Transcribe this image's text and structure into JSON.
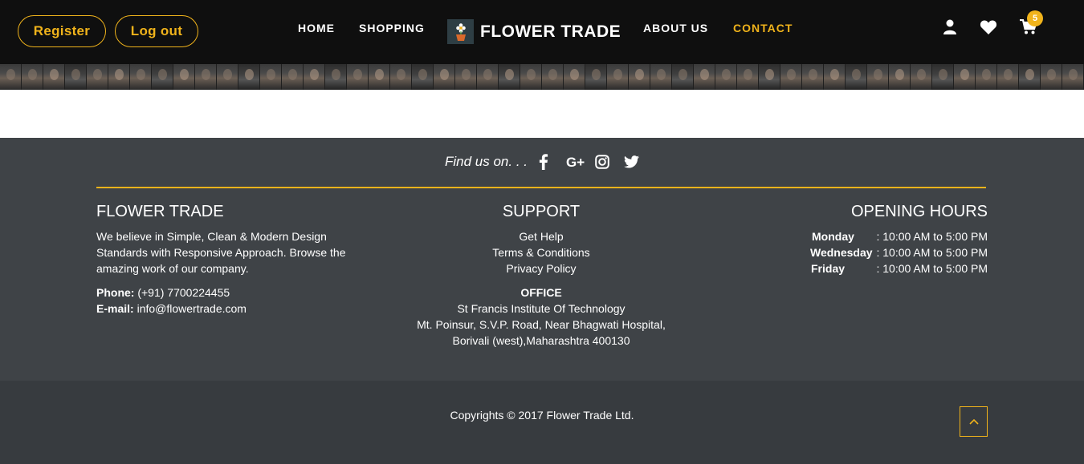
{
  "header": {
    "register_label": "Register",
    "logout_label": "Log out",
    "nav": {
      "home": "HOME",
      "shopping": "SHOPPING",
      "about": "ABOUT US",
      "contact": "CONTACT"
    },
    "logo_text": "FLOWER TRADE",
    "icons": {
      "user": "user-icon",
      "heart": "heart-icon",
      "cart": "cart-icon"
    },
    "cart_count": "5",
    "accent_color": "#f0b31b"
  },
  "footer": {
    "find_us_label": "Find us on. . .",
    "social_icons": [
      "facebook-icon",
      "google-plus-icon",
      "instagram-icon",
      "twitter-icon"
    ],
    "about": {
      "title": "FLOWER TRADE",
      "description": "We believe in Simple, Clean & Modern Design Standards with Responsive Approach. Browse the amazing work of our company.",
      "phone_label": "Phone:",
      "phone": "(+91) 7700224455",
      "email_label": "E-mail:",
      "email": "info@flowertrade.com"
    },
    "support": {
      "title": "SUPPORT",
      "links": [
        "Get Help",
        "Terms & Conditions",
        "Privacy Policy"
      ],
      "office_title": "OFFICE",
      "office_lines": [
        "St Francis Institute Of Technology",
        "Mt. Poinsur, S.V.P. Road, Near Bhagwati Hospital,",
        "Borivali (west),Maharashtra 400130"
      ]
    },
    "hours": {
      "title": "OPENING HOURS",
      "rows": [
        {
          "day": "Monday",
          "time": ": 10:00 AM to 5:00 PM"
        },
        {
          "day": "Wednesday",
          "time": ": 10:00 AM to 5:00 PM"
        },
        {
          "day": "Friday",
          "time": ": 10:00 AM to 5:00 PM"
        }
      ]
    },
    "copyright": "Copyrights © 2017 Flower Trade Ltd."
  }
}
